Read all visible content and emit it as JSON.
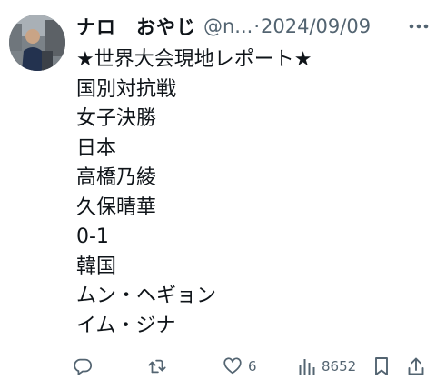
{
  "tweet": {
    "display_name": "ナロ　おやじ",
    "handle": "@n...",
    "separator": "·",
    "date": "2024/09/09",
    "lines": [
      "★世界大会現地レポート★",
      "国別対抗戦",
      "女子決勝",
      "日本",
      "高橋乃綾",
      "久保晴華",
      "0-1",
      "韓国",
      "ムン・ヘギョン",
      "イム・ジナ"
    ]
  },
  "actions": {
    "reply_count": "",
    "retweet_count": "",
    "like_count": "6",
    "views_count": "8652"
  },
  "colors": {
    "text": "#0f1419",
    "secondary": "#536471",
    "background": "#ffffff"
  },
  "icons": {
    "more": "more-icon",
    "reply": "reply-icon",
    "retweet": "retweet-icon",
    "like": "heart-icon",
    "views": "views-icon",
    "bookmark": "bookmark-icon",
    "share": "share-icon"
  }
}
